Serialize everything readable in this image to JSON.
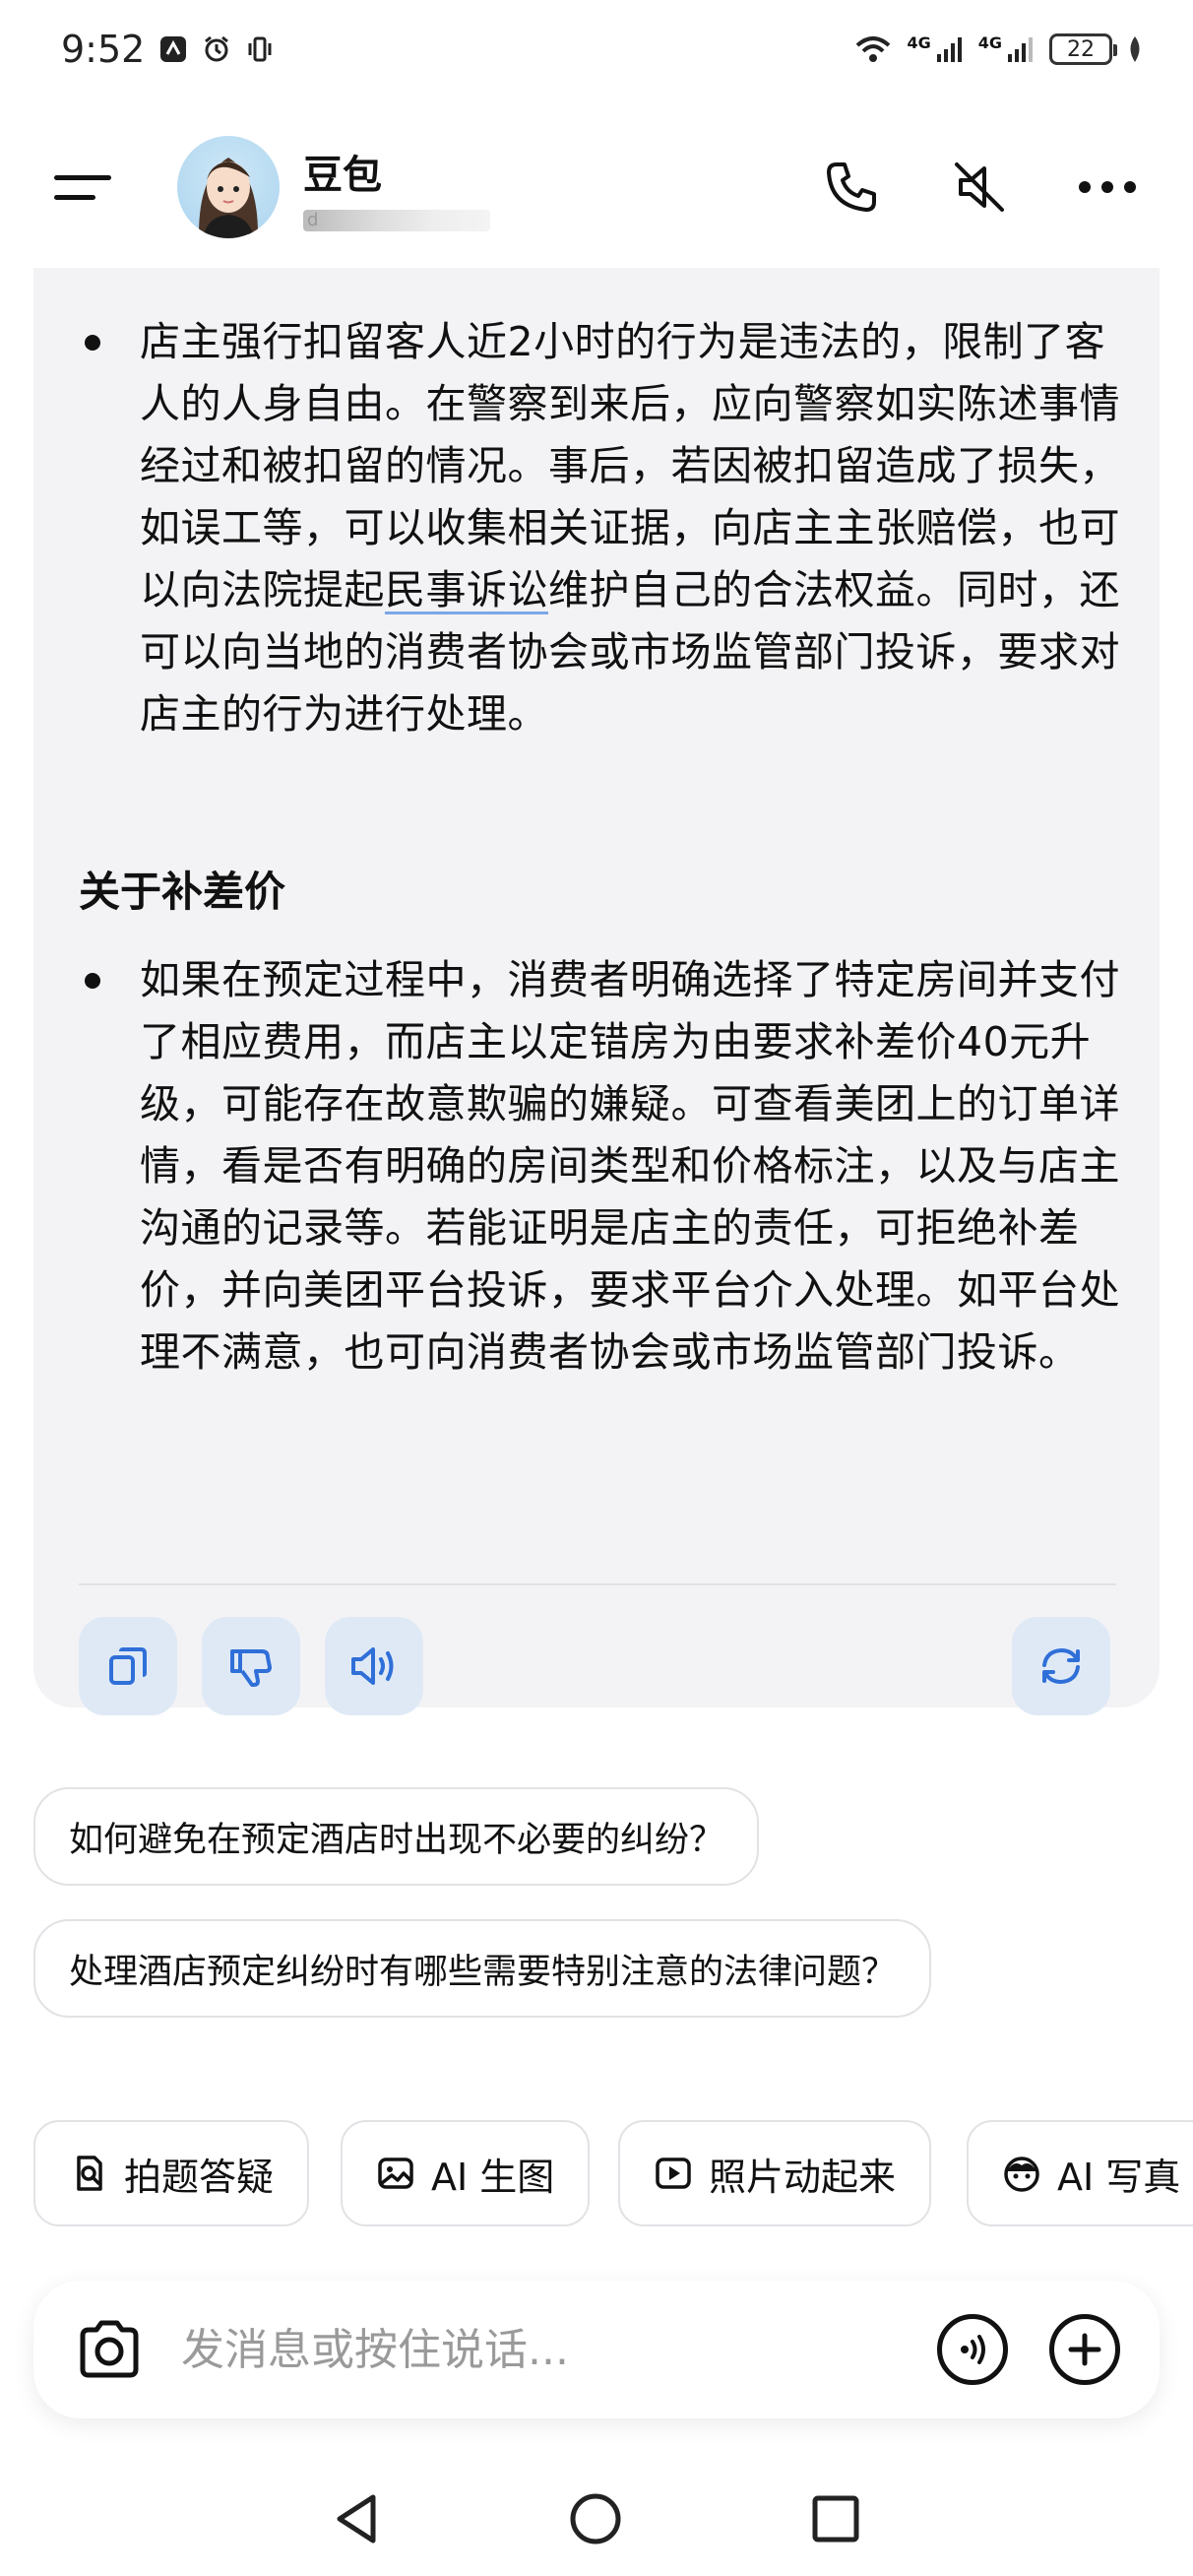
{
  "status_bar": {
    "time": "9:52",
    "network_left": "4G",
    "network_right": "4G",
    "battery": "22"
  },
  "header": {
    "bot_name": "豆包",
    "bot_subtitle": "d"
  },
  "message": {
    "bullet1_before": "店主强行扣留客人近2小时的行为是违法的，限制了客人的人身自由。在警察到来后，应向警察如实陈述事情经过和被扣留的情况。事后，若因被扣留造成了损失，如误工等，可以收集相关证据，向店主主张赔偿，也可以向法院提起",
    "bullet1_link": "民事诉讼",
    "bullet1_after": "维护自己的合法权益。同时，还可以向当地的消费者协会或市场监管部门投诉，要求对店主的行为进行处理。",
    "section_heading": "关于补差价",
    "bullet2": "如果在预定过程中，消费者明确选择了特定房间并支付了相应费用，而店主以定错房为由要求补差价40元升级，可能存在故意欺骗的嫌疑。可查看美团上的订单详情，看是否有明确的房间类型和价格标注，以及与店主沟通的记录等。若能证明是店主的责任，可拒绝补差价，并向美团平台投诉，要求平台介入处理。如平台处理不满意，也可向消费者协会或市场监管部门投诉。"
  },
  "suggestions": [
    "如何避免在预定酒店时出现不必要的纠纷？",
    "处理酒店预定纠纷时有哪些需要特别注意的法律问题？"
  ],
  "tools": [
    {
      "label": "拍题答疑",
      "icon": "photo-question-icon"
    },
    {
      "label": "AI 生图",
      "icon": "image-icon"
    },
    {
      "label": "照片动起来",
      "icon": "play-icon"
    },
    {
      "label": "AI 写真",
      "icon": "face-icon"
    }
  ],
  "input": {
    "placeholder": "发消息或按住说话..."
  },
  "colors": {
    "card_bg": "#f3f3f5",
    "action_btn_bg": "#dfe9f6",
    "action_icon": "#2f6fd8",
    "link_underline": "#7ba7e6"
  }
}
